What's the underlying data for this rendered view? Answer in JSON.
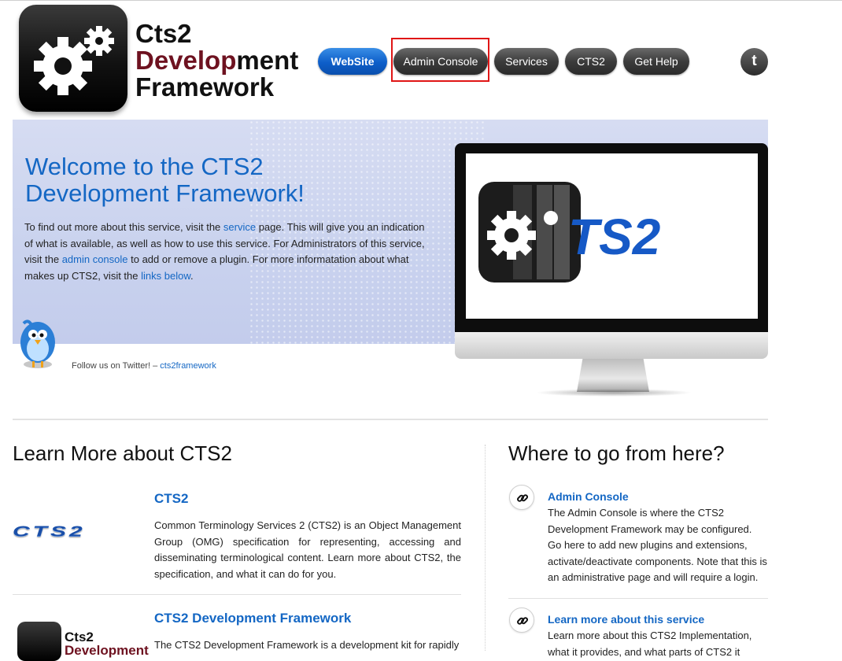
{
  "logo": {
    "line1": "Cts2",
    "line2_prefix": "Develop",
    "line2_suffix": "ment",
    "line3": "Framework"
  },
  "nav": {
    "items": [
      {
        "label": "WebSite",
        "active": true
      },
      {
        "label": "Admin Console",
        "active": false
      },
      {
        "label": "Services",
        "active": false
      },
      {
        "label": "CTS2",
        "active": false
      },
      {
        "label": "Get Help",
        "active": false
      }
    ],
    "twitter_icon": "twitter-t-icon",
    "highlighted_item": "Admin Console"
  },
  "hero": {
    "title_line1": "Welcome to the CTS2",
    "title_line2": "Development Framework!",
    "para": {
      "t1": "To find out more about this service, visit the ",
      "link_service": "service",
      "t2": " page. This will give you an indication of what is available, as well as how to use this service. For Administrators of this service, visit the ",
      "link_admin": "admin console",
      "t3": " to add or remove a plugin. For more informatation about what makes up CTS2, visit the ",
      "link_below": "links below",
      "t4": "."
    },
    "follow_text": "Follow us on Twitter! – ",
    "follow_link": "cts2framework",
    "screen_wordmark": "TS2"
  },
  "learn_more": {
    "title": "Learn More about CTS2",
    "items": [
      {
        "logo_text": "CTS2",
        "title": "CTS2",
        "text": "Common Terminology Services 2 (CTS2) is an Object Management Group (OMG) specification for representing, accessing and disseminating terminological content. Learn more about CTS2, the specification, and what it can do for you."
      },
      {
        "logo_line1": "Cts2",
        "logo_line2": "Development",
        "title": "CTS2 Development Framework",
        "text": "The CTS2 Development Framework is a development kit for rapidly"
      }
    ]
  },
  "where_to_go": {
    "title": "Where to go from here?",
    "items": [
      {
        "icon": "link-icon",
        "title": "Admin Console",
        "text": "The Admin Console is where the CTS2 Development Framework may be configured. Go here to add new plugins and extensions, activate/deactivate components. Note that this is an administrative page and will require a login."
      },
      {
        "icon": "link-icon",
        "title": "Learn more about this service",
        "text": "Learn more about this CTS2 Implementation, what it provides, and what parts of CTS2 it"
      }
    ]
  },
  "colors": {
    "brand_blue": "#1467c4",
    "brand_maroon": "#6e1220",
    "highlight_red": "#e01616"
  }
}
